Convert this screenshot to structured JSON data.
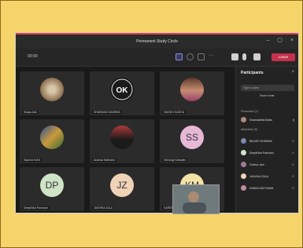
{
  "window": {
    "title": "Permanent Study Circle"
  },
  "toolbar": {
    "timer": "00:00",
    "leave_label": "Leave"
  },
  "gallery": {
    "tiles": [
      {
        "name": "Swaja Jain"
      },
      {
        "name": "SHUBHAM SHARMA"
      },
      {
        "name": "SAKSHI SUDHA"
      },
      {
        "name": "Sapnna Kohli"
      },
      {
        "name": "Ananda Malhotra"
      },
      {
        "name": "Shivangi Sahadev",
        "initials": "SS"
      },
      {
        "name": "Deepthika Pamnani",
        "initials": "DP"
      },
      {
        "name": "JANVIKA ZALA",
        "initials": "JZ"
      },
      {
        "name": "KAREENA MOTWANI",
        "initials": "KM"
      }
    ]
  },
  "participants": {
    "title": "Participants",
    "search_placeholder": "Type a name",
    "share_label": "Share invite",
    "presenters_header": "Presenters (1)",
    "attendees_header": "Attendees (9)",
    "presenters": [
      {
        "name": "Swarnalatha Batra"
      }
    ],
    "attendees": [
      {
        "name": "BIKASH SHARMA"
      },
      {
        "name": "Deepthika Pamnani"
      },
      {
        "name": "Chetna Jain"
      },
      {
        "name": "JANVIKA ZALA"
      },
      {
        "name": "KANIKA MOTWANI"
      }
    ]
  },
  "colors": {
    "leave": "#c4314b",
    "accent": "#8b8bf0",
    "background": "#f5d46a"
  }
}
